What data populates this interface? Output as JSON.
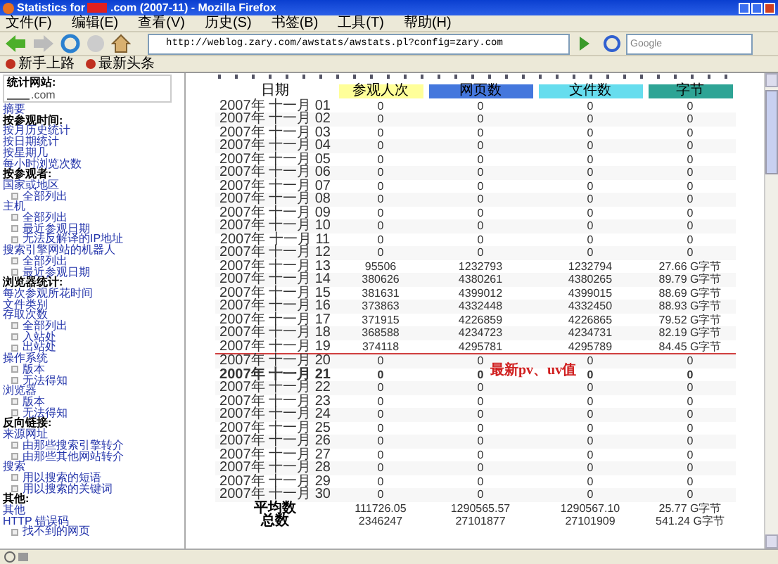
{
  "window": {
    "title_before": "Statistics for",
    "title_after": ".com (2007-11) - Mozilla Firefox"
  },
  "menu": [
    "文件(F)",
    "编辑(E)",
    "查看(V)",
    "历史(S)",
    "书签(B)",
    "工具(T)",
    "帮助(H)"
  ],
  "address": {
    "value": "http://weblog.zary.com/awstats/awstats.pl?config=zary.com"
  },
  "search": {
    "placeholder": "Google"
  },
  "bookmarks": [
    "新手上路",
    "最新头条"
  ],
  "sidebar": {
    "site_label": "统计网站:",
    "site_value": ".com",
    "items": [
      {
        "kind": "link",
        "text": "摘要"
      },
      {
        "kind": "heading",
        "text": "按参观时间:"
      },
      {
        "kind": "link",
        "text": "按月历史统计"
      },
      {
        "kind": "link",
        "text": "按日期统计"
      },
      {
        "kind": "link",
        "text": "按星期几"
      },
      {
        "kind": "link",
        "text": "每小时浏览次数"
      },
      {
        "kind": "heading",
        "text": "按参观者:"
      },
      {
        "kind": "link",
        "text": "国家或地区"
      },
      {
        "kind": "sub",
        "text": "全部列出"
      },
      {
        "kind": "link",
        "text": "主机"
      },
      {
        "kind": "sub",
        "text": "全部列出"
      },
      {
        "kind": "sub",
        "text": "最近参观日期"
      },
      {
        "kind": "sub",
        "text": "无法反解译的IP地址"
      },
      {
        "kind": "link",
        "text": "搜索引擎网站的机器人"
      },
      {
        "kind": "sub",
        "text": "全部列出"
      },
      {
        "kind": "sub",
        "text": "最近参观日期"
      },
      {
        "kind": "heading",
        "text": "浏览器统计:"
      },
      {
        "kind": "link",
        "text": "每次参观所花时间"
      },
      {
        "kind": "link",
        "text": "文件类别"
      },
      {
        "kind": "link",
        "text": "存取次数"
      },
      {
        "kind": "sub",
        "text": "全部列出"
      },
      {
        "kind": "sub",
        "text": "入站处"
      },
      {
        "kind": "sub",
        "text": "出站处"
      },
      {
        "kind": "link",
        "text": "操作系统"
      },
      {
        "kind": "sub",
        "text": "版本"
      },
      {
        "kind": "sub",
        "text": "无法得知"
      },
      {
        "kind": "link",
        "text": "浏览器"
      },
      {
        "kind": "sub",
        "text": "版本"
      },
      {
        "kind": "sub",
        "text": "无法得知"
      },
      {
        "kind": "heading",
        "text": "反向链接:"
      },
      {
        "kind": "link",
        "text": "来源网址"
      },
      {
        "kind": "sub",
        "text": "由那些搜索引擎转介"
      },
      {
        "kind": "sub",
        "text": "由那些其他网站转介"
      },
      {
        "kind": "link",
        "text": "搜索"
      },
      {
        "kind": "sub",
        "text": "用以搜索的短语"
      },
      {
        "kind": "sub",
        "text": "用以搜索的关键词"
      },
      {
        "kind": "heading",
        "text": "其他:"
      },
      {
        "kind": "link",
        "text": "其他"
      },
      {
        "kind": "link",
        "text": "HTTP 错误码"
      },
      {
        "kind": "sub",
        "text": "找不到的网页"
      }
    ]
  },
  "table": {
    "columns": [
      {
        "label": "日期"
      },
      {
        "label": "参观人次",
        "color": "#ffff99"
      },
      {
        "label": "网页数",
        "color": "#4477dd"
      },
      {
        "label": "文件数",
        "color": "#66ddee"
      },
      {
        "label": "字节",
        "color": "#2ea495"
      }
    ],
    "rows": [
      {
        "date": "2007年 十一月 01",
        "values": [
          "0",
          "0",
          "0",
          "0"
        ],
        "current": false,
        "marked": false
      },
      {
        "date": "2007年 十一月 02",
        "values": [
          "0",
          "0",
          "0",
          "0"
        ],
        "current": false,
        "marked": false
      },
      {
        "date": "2007年 十一月 03",
        "values": [
          "0",
          "0",
          "0",
          "0"
        ],
        "current": false,
        "marked": false
      },
      {
        "date": "2007年 十一月 04",
        "values": [
          "0",
          "0",
          "0",
          "0"
        ],
        "current": false,
        "marked": false
      },
      {
        "date": "2007年 十一月 05",
        "values": [
          "0",
          "0",
          "0",
          "0"
        ],
        "current": false,
        "marked": false
      },
      {
        "date": "2007年 十一月 06",
        "values": [
          "0",
          "0",
          "0",
          "0"
        ],
        "current": false,
        "marked": false
      },
      {
        "date": "2007年 十一月 07",
        "values": [
          "0",
          "0",
          "0",
          "0"
        ],
        "current": false,
        "marked": false
      },
      {
        "date": "2007年 十一月 08",
        "values": [
          "0",
          "0",
          "0",
          "0"
        ],
        "current": false,
        "marked": false
      },
      {
        "date": "2007年 十一月 09",
        "values": [
          "0",
          "0",
          "0",
          "0"
        ],
        "current": false,
        "marked": false
      },
      {
        "date": "2007年 十一月 10",
        "values": [
          "0",
          "0",
          "0",
          "0"
        ],
        "current": false,
        "marked": false
      },
      {
        "date": "2007年 十一月 11",
        "values": [
          "0",
          "0",
          "0",
          "0"
        ],
        "current": false,
        "marked": false
      },
      {
        "date": "2007年 十一月 12",
        "values": [
          "0",
          "0",
          "0",
          "0"
        ],
        "current": false,
        "marked": false
      },
      {
        "date": "2007年 十一月 13",
        "values": [
          "95506",
          "1232793",
          "1232794",
          "27.66 G字节"
        ],
        "current": false,
        "marked": false
      },
      {
        "date": "2007年 十一月 14",
        "values": [
          "380626",
          "4380261",
          "4380265",
          "89.79 G字节"
        ],
        "current": false,
        "marked": false
      },
      {
        "date": "2007年 十一月 15",
        "values": [
          "381631",
          "4399012",
          "4399015",
          "88.69 G字节"
        ],
        "current": false,
        "marked": false
      },
      {
        "date": "2007年 十一月 16",
        "values": [
          "373863",
          "4332448",
          "4332450",
          "88.93 G字节"
        ],
        "current": false,
        "marked": false
      },
      {
        "date": "2007年 十一月 17",
        "values": [
          "371915",
          "4226859",
          "4226865",
          "79.52 G字节"
        ],
        "current": false,
        "marked": false
      },
      {
        "date": "2007年 十一月 18",
        "values": [
          "368588",
          "4234723",
          "4234731",
          "82.19 G字节"
        ],
        "current": false,
        "marked": false
      },
      {
        "date": "2007年 十一月 19",
        "values": [
          "374118",
          "4295781",
          "4295789",
          "84.45 G字节"
        ],
        "current": false,
        "marked": true
      },
      {
        "date": "2007年 十一月 20",
        "values": [
          "0",
          "0",
          "0",
          "0"
        ],
        "current": false,
        "marked": false
      },
      {
        "date": "2007年 十一月 21",
        "values": [
          "0",
          "0",
          "0",
          "0"
        ],
        "current": true,
        "marked": false
      },
      {
        "date": "2007年 十一月 22",
        "values": [
          "0",
          "0",
          "0",
          "0"
        ],
        "current": false,
        "marked": false
      },
      {
        "date": "2007年 十一月 23",
        "values": [
          "0",
          "0",
          "0",
          "0"
        ],
        "current": false,
        "marked": false
      },
      {
        "date": "2007年 十一月 24",
        "values": [
          "0",
          "0",
          "0",
          "0"
        ],
        "current": false,
        "marked": false
      },
      {
        "date": "2007年 十一月 25",
        "values": [
          "0",
          "0",
          "0",
          "0"
        ],
        "current": false,
        "marked": false
      },
      {
        "date": "2007年 十一月 26",
        "values": [
          "0",
          "0",
          "0",
          "0"
        ],
        "current": false,
        "marked": false
      },
      {
        "date": "2007年 十一月 27",
        "values": [
          "0",
          "0",
          "0",
          "0"
        ],
        "current": false,
        "marked": false
      },
      {
        "date": "2007年 十一月 28",
        "values": [
          "0",
          "0",
          "0",
          "0"
        ],
        "current": false,
        "marked": false
      },
      {
        "date": "2007年 十一月 29",
        "values": [
          "0",
          "0",
          "0",
          "0"
        ],
        "current": false,
        "marked": false
      },
      {
        "date": "2007年 十一月 30",
        "values": [
          "0",
          "0",
          "0",
          "0"
        ],
        "current": false,
        "marked": false
      }
    ],
    "footer": [
      {
        "label": "平均数",
        "values": [
          "111726.05",
          "1290565.57",
          "1290567.10",
          "25.77 G字节"
        ]
      },
      {
        "label": "总数",
        "values": [
          "2346247",
          "27101877",
          "27101909",
          "541.24 G字节"
        ]
      }
    ]
  },
  "annotation": {
    "text": "最新pv、uv值"
  }
}
